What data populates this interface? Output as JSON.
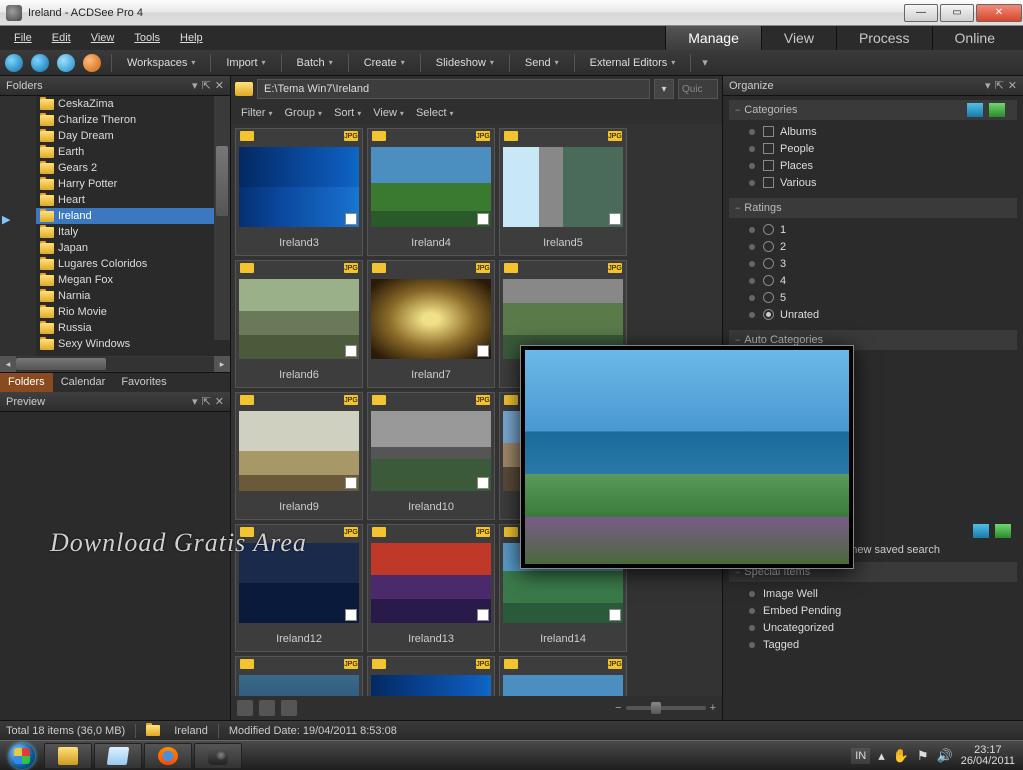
{
  "window": {
    "title": "Ireland - ACDSee Pro 4"
  },
  "menubar": [
    "File",
    "Edit",
    "View",
    "Tools",
    "Help"
  ],
  "modes": {
    "items": [
      "Manage",
      "View",
      "Process",
      "Online"
    ],
    "active": "Manage"
  },
  "toolbar_menus": [
    "Workspaces",
    "Import",
    "Batch",
    "Create",
    "Slideshow",
    "Send",
    "External Editors"
  ],
  "panels": {
    "folders_title": "Folders",
    "preview_title": "Preview",
    "organize_title": "Organize"
  },
  "folders": {
    "items": [
      "CeskaZima",
      "Charlize Theron",
      "Day Dream",
      "Earth",
      "Gears 2",
      "Harry Potter",
      "Heart",
      "Ireland",
      "Italy",
      "Japan",
      "Lugares Coloridos",
      "Megan Fox",
      "Narnia",
      "Rio Movie",
      "Russia",
      "Sexy Windows"
    ],
    "selected": "Ireland"
  },
  "left_tabs": {
    "items": [
      "Folders",
      "Calendar",
      "Favorites"
    ],
    "active": "Folders"
  },
  "path": "E:\\Tema Win7\\Ireland",
  "quick_placeholder": "Quic",
  "filter_menus": [
    "Filter",
    "Group",
    "Sort",
    "View",
    "Select"
  ],
  "thumbs": {
    "badge": "JPG",
    "rows": [
      [
        "Ireland3",
        "Ireland4",
        "Ireland5"
      ],
      [
        "Ireland6",
        "Ireland7",
        ""
      ],
      [
        "Ireland9",
        "Ireland10",
        ""
      ],
      [
        "Ireland12",
        "Ireland13",
        "Ireland14"
      ],
      [
        "",
        "",
        ""
      ]
    ]
  },
  "organize": {
    "sections": {
      "categories": {
        "title": "Categories",
        "items": [
          "Albums",
          "People",
          "Places",
          "Various"
        ]
      },
      "ratings": {
        "title": "Ratings",
        "items": [
          "1",
          "2",
          "3",
          "4",
          "5",
          "Unrated"
        ],
        "selected": "Unrated"
      },
      "auto": {
        "title": "Auto Categories"
      },
      "special": {
        "title": "Special Items",
        "items": [
          "Image Well",
          "Embed Pending",
          "Uncategorized",
          "Tagged"
        ]
      }
    },
    "saved_search": "Create a new saved search"
  },
  "status": {
    "total": "Total 18 items  (36,0 MB)",
    "folder": "Ireland",
    "modified": "Modified Date: 19/04/2011 8:53:08"
  },
  "taskbar": {
    "lang": "IN",
    "time": "23:17",
    "date": "26/04/2011"
  },
  "watermark": "Download Gratis Area"
}
